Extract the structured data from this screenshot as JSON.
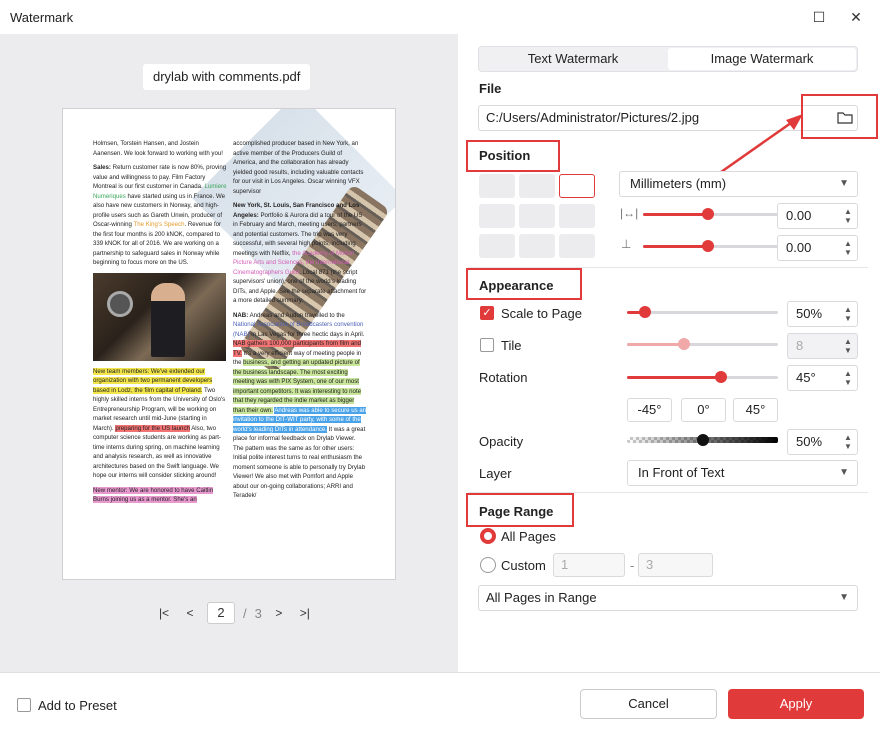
{
  "window": {
    "title": "Watermark",
    "minimize": "☐",
    "close": "✕"
  },
  "preview": {
    "filename": "drylab with comments.pdf",
    "page_current": "2",
    "page_sep": "/",
    "page_total": "3",
    "doc": {
      "c1p1": "Holmsen, Torstein Hansen, and Jostein Aanensen. We look forward to working with you!",
      "c1_sales_head": "Sales:",
      "c1_sales_a": " Return customer rate is now 80%, proving value and willingness to pay. Film Factory Montreal is our first customer in Canada. ",
      "c1_sales_link1": "Lumiere Numeriques",
      "c1_sales_b": " have started using us in France. We also have new customers in Norway, and high-profile users such as Gareth Unwin, producer of Oscar-winning ",
      "c1_sales_link2": "The King's Speech",
      "c1_sales_c": ". Revenue for the first four months is 200 kNOK, compared to 339 kNOK for all of 2016. We are working on a partnership to safeguard sales in Norway while beginning to focus more on the US.",
      "c1_team_hl": "New team members: We've extended our organization with two permanent developers based in Lodz, the film capital of Poland.",
      "c1_team_a": " Two highly skilled interns from the University of Oslo's Entrepreneurship Program, will be working on market research until mid-June (starting in March). ",
      "c1_team_hl2": "preparing for the US launch",
      "c1_team_b": " Also, two computer science students are working as part-time interns during spring, on machine learning and analysis research, as well as innovative architectures based on the Swift language. We hope our interns will consider sticking around!",
      "c1_mentor_hl": "New mentor: We are honored to have Caitlin Burns joining us as a mentor. She's an",
      "c2p1": "accomplished producer based in New York, an active member of the Producers Guild of America, and the collaboration has already yielded good results, including valuable contacts for our visit in Los Angeles. Oscar winning VFX supervisor",
      "c2_ny_head": "New York, St. Louis, San Francisco and Los Angeles:",
      "c2_ny_a": " Portfolio & Aurora did a tour of the US in February and March, meeting users, partners and potential customers. The trip was very successful, with several high points, including meetings with Netflix, ",
      "c2_ny_link": "the Academy of Motion Picture Arts and Sciences, the International Cinematographers Guild",
      "c2_ny_b": ", Local 871 (the script supervisors' union), one of the world's leading DITs, and Apple. See the separate attachment for a more detailed summary.",
      "c2_nab_head": "NAB:",
      "c2_nab_a": " Andreas and Audun travelled to the ",
      "c2_nab_link": "National Association of Broadcasters convention (NAB)",
      "c2_nab_b": " in Las Vegas for three hectic days in April. ",
      "c2_nab_hl": "NAB gathers 100,000 participants from film and TV.",
      "c2_nab_c": " It's a very efficient way of meeting people in the ",
      "c2_nab_hl2": "business, and getting an updated picture of the business landscape. The most exciting meeting was with PIX System, one of our most important competitors. It was interesting to note that they regarded the indie market as bigger than their own.",
      "c2_nab_hl3": "Andreas was able to secure us an invitation to the DIT-WIT party, with some of the world's leading DITs in attendance.",
      "c2_nab_d": " It was a great place for informal feedback on Drylab Viewer. The pattern was the same as for other users: Initial polite interest turns to real enthusiasm the moment someone is able to personally try Drylab Viewer! We also met with Pomfort and Apple about our on-going collaborations; ARRI and Teradek/"
    }
  },
  "tabs": [
    {
      "label": "Text Watermark"
    },
    {
      "label": "Image Watermark"
    }
  ],
  "file": {
    "title": "File",
    "path": "C:/Users/Administrator/Pictures/2.jpg"
  },
  "position": {
    "title": "Position",
    "unit": "Millimeters (mm)",
    "h_offset": "0.00",
    "v_offset": "0.00",
    "h_slider": 0.48,
    "v_slider": 0.48
  },
  "appearance": {
    "title": "Appearance",
    "scale_label": "Scale to Page",
    "scale_value": "50%",
    "scale_slider": 0.12,
    "scale_checked": true,
    "tile_label": "Tile",
    "tile_value": "8",
    "tile_slider": 0.38,
    "rotation_label": "Rotation",
    "rotation_value": "45°",
    "rotation_slider": 0.62,
    "rot_buttons": [
      "-45°",
      "0°",
      "45°"
    ],
    "opacity_label": "Opacity",
    "opacity_value": "50%",
    "opacity_slider": 0.5,
    "layer_label": "Layer",
    "layer_value": "In Front of Text"
  },
  "page_range": {
    "title": "Page Range",
    "all_label": "All Pages",
    "custom_label": "Custom",
    "custom_from": "1",
    "custom_dash": "-",
    "custom_to": "3",
    "subset": "All Pages in Range"
  },
  "footer": {
    "preset_label": "Add to Preset",
    "cancel_label": "Cancel",
    "apply_label": "Apply"
  },
  "colors": {
    "accent": "#e03a3a"
  }
}
